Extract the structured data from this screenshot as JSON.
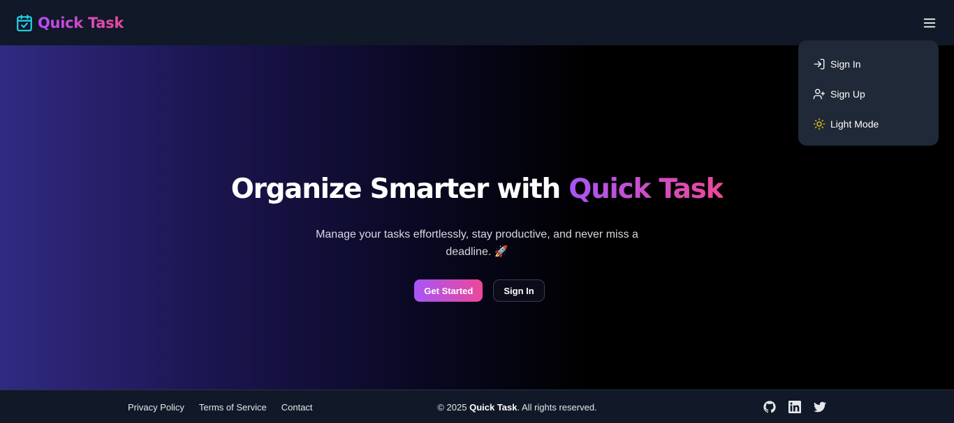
{
  "header": {
    "brand": "Quick Task",
    "brand_icon": "calendar-check-icon",
    "menu_icon": "hamburger-menu-icon"
  },
  "dropdown": {
    "items": [
      {
        "label": "Sign In",
        "icon": "sign-in-icon"
      },
      {
        "label": "Sign Up",
        "icon": "user-plus-icon"
      },
      {
        "label": "Light Mode",
        "icon": "sun-icon"
      }
    ]
  },
  "hero": {
    "title_prefix": "Organize Smarter with",
    "title_accent": "Quick Task",
    "subtitle": "Manage your tasks effortlessly, stay productive, and never miss a deadline. 🚀",
    "primary_button": "Get Started",
    "secondary_button": "Sign In"
  },
  "footer": {
    "links": [
      "Privacy Policy",
      "Terms of Service",
      "Contact"
    ],
    "copyright_prefix": "© 2025",
    "copyright_brand": "Quick Task",
    "copyright_suffix": ". All rights reserved.",
    "social": [
      "github-icon",
      "linkedin-icon",
      "twitter-icon"
    ]
  },
  "colors": {
    "accent_start": "#a855f7",
    "accent_end": "#ec4899",
    "brand_icon": "#22d3ee",
    "header_bg": "#111827",
    "dropdown_bg": "#1f2937",
    "sun_icon": "#facc15"
  }
}
